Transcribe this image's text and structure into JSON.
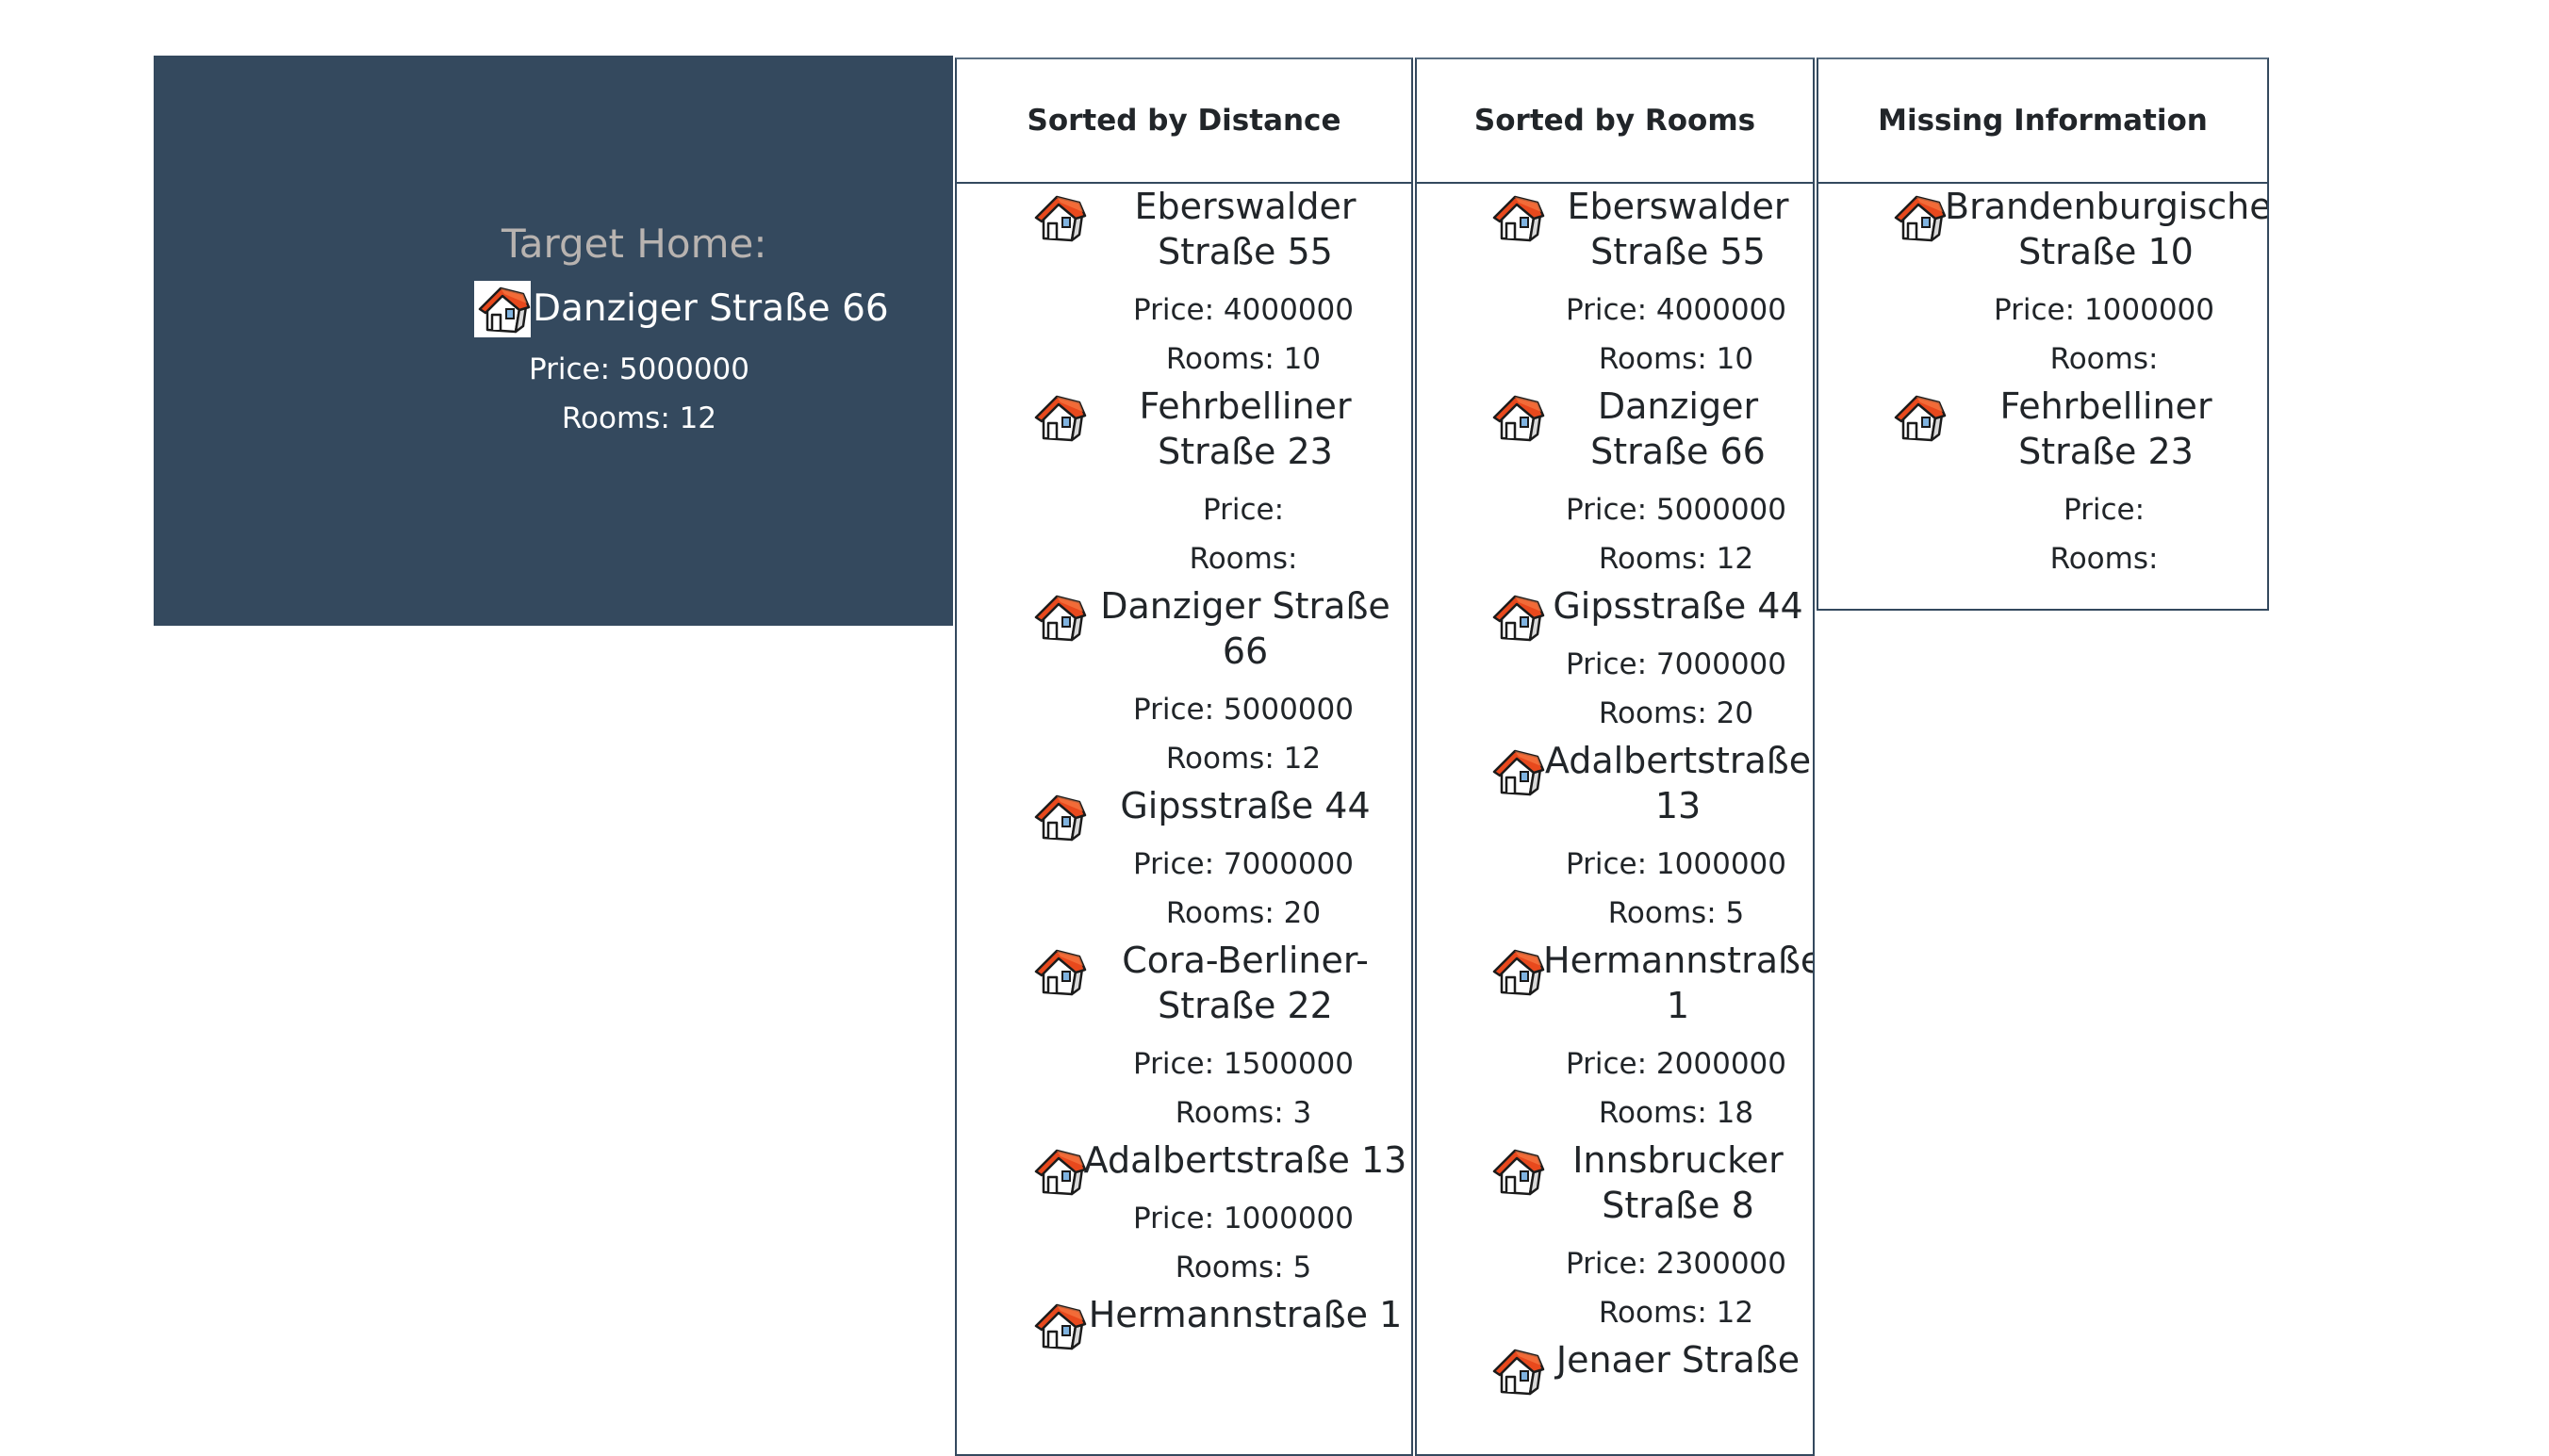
{
  "target": {
    "heading": "Target Home:",
    "name": "Danziger Straße 66",
    "price": "Price: 5000000",
    "rooms": "Rooms: 12",
    "icon": "house-icon"
  },
  "columns": {
    "distance": {
      "title": "Sorted by Distance",
      "items": [
        {
          "name": "Eberswalder Straße 55",
          "price": "Price: 4000000",
          "rooms": "Rooms: 10"
        },
        {
          "name": "Fehrbelliner Straße 23",
          "price": "Price:",
          "rooms": "Rooms:"
        },
        {
          "name": "Danziger Straße 66",
          "price": "Price: 5000000",
          "rooms": "Rooms: 12"
        },
        {
          "name": "Gipsstraße 44",
          "price": "Price: 7000000",
          "rooms": "Rooms: 20"
        },
        {
          "name": "Cora-Berliner-Straße 22",
          "price": "Price: 1500000",
          "rooms": "Rooms: 3"
        },
        {
          "name": "Adalbertstraße 13",
          "price": "Price: 1000000",
          "rooms": "Rooms: 5"
        },
        {
          "name": "Hermannstraße 1",
          "price": "",
          "rooms": ""
        }
      ]
    },
    "rooms": {
      "title": "Sorted by Rooms",
      "items": [
        {
          "name": "Eberswalder Straße 55",
          "price": "Price: 4000000",
          "rooms": "Rooms: 10"
        },
        {
          "name": "Danziger Straße 66",
          "price": "Price: 5000000",
          "rooms": "Rooms: 12"
        },
        {
          "name": "Gipsstraße 44",
          "price": "Price: 7000000",
          "rooms": "Rooms: 20"
        },
        {
          "name": "Adalbertstraße 13",
          "price": "Price: 1000000",
          "rooms": "Rooms: 5"
        },
        {
          "name": "Hermannstraße 1",
          "price": "Price: 2000000",
          "rooms": "Rooms: 18"
        },
        {
          "name": "Innsbrucker Straße 8",
          "price": "Price: 2300000",
          "rooms": "Rooms: 12"
        },
        {
          "name": "Jenaer Straße",
          "price": "",
          "rooms": ""
        }
      ]
    },
    "missing": {
      "title": "Missing Information",
      "items": [
        {
          "name": "Brandenburgische Straße 10",
          "price": "Price: 1000000",
          "rooms": "Rooms:"
        },
        {
          "name": "Fehrbelliner Straße 23",
          "price": "Price:",
          "rooms": "Rooms:"
        }
      ]
    }
  },
  "colors": {
    "target_bg": "#34495e",
    "heading": "#b8b3b0",
    "roof": "#e8491d"
  }
}
